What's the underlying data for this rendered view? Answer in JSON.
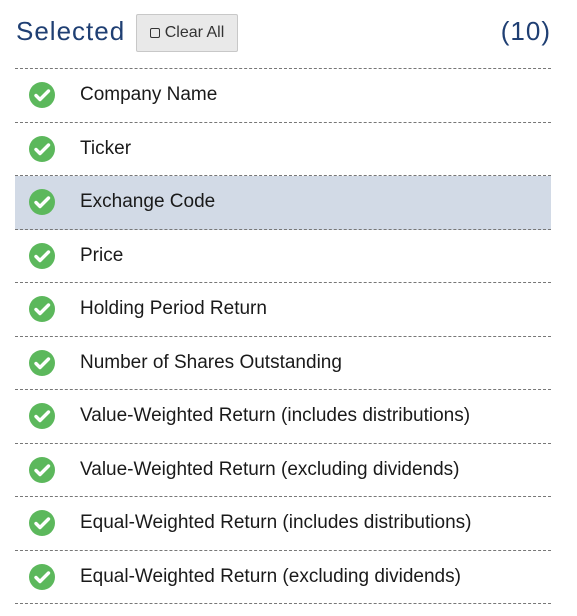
{
  "header": {
    "title": "Selected",
    "clear_label": "Clear All",
    "count": "(10)"
  },
  "colors": {
    "check": "#5cb85c",
    "title": "#1f3f73",
    "highlight": "#d2dae6"
  },
  "items": [
    {
      "label": "Company Name",
      "icon": "check-circle-icon"
    },
    {
      "label": "Ticker",
      "icon": "check-circle-icon"
    },
    {
      "label": "Exchange Code",
      "icon": "check-circle-icon",
      "highlighted": true
    },
    {
      "label": "Price",
      "icon": "check-circle-icon"
    },
    {
      "label": "Holding Period Return",
      "icon": "check-circle-icon"
    },
    {
      "label": "Number of Shares Outstanding",
      "icon": "check-circle-icon"
    },
    {
      "label": "Value-Weighted Return (includes distributions)",
      "icon": "check-circle-icon"
    },
    {
      "label": "Value-Weighted Return (excluding dividends)",
      "icon": "check-circle-icon"
    },
    {
      "label": "Equal-Weighted Return (includes distributions)",
      "icon": "check-circle-icon"
    },
    {
      "label": "Equal-Weighted Return (excluding dividends)",
      "icon": "check-circle-icon"
    }
  ]
}
